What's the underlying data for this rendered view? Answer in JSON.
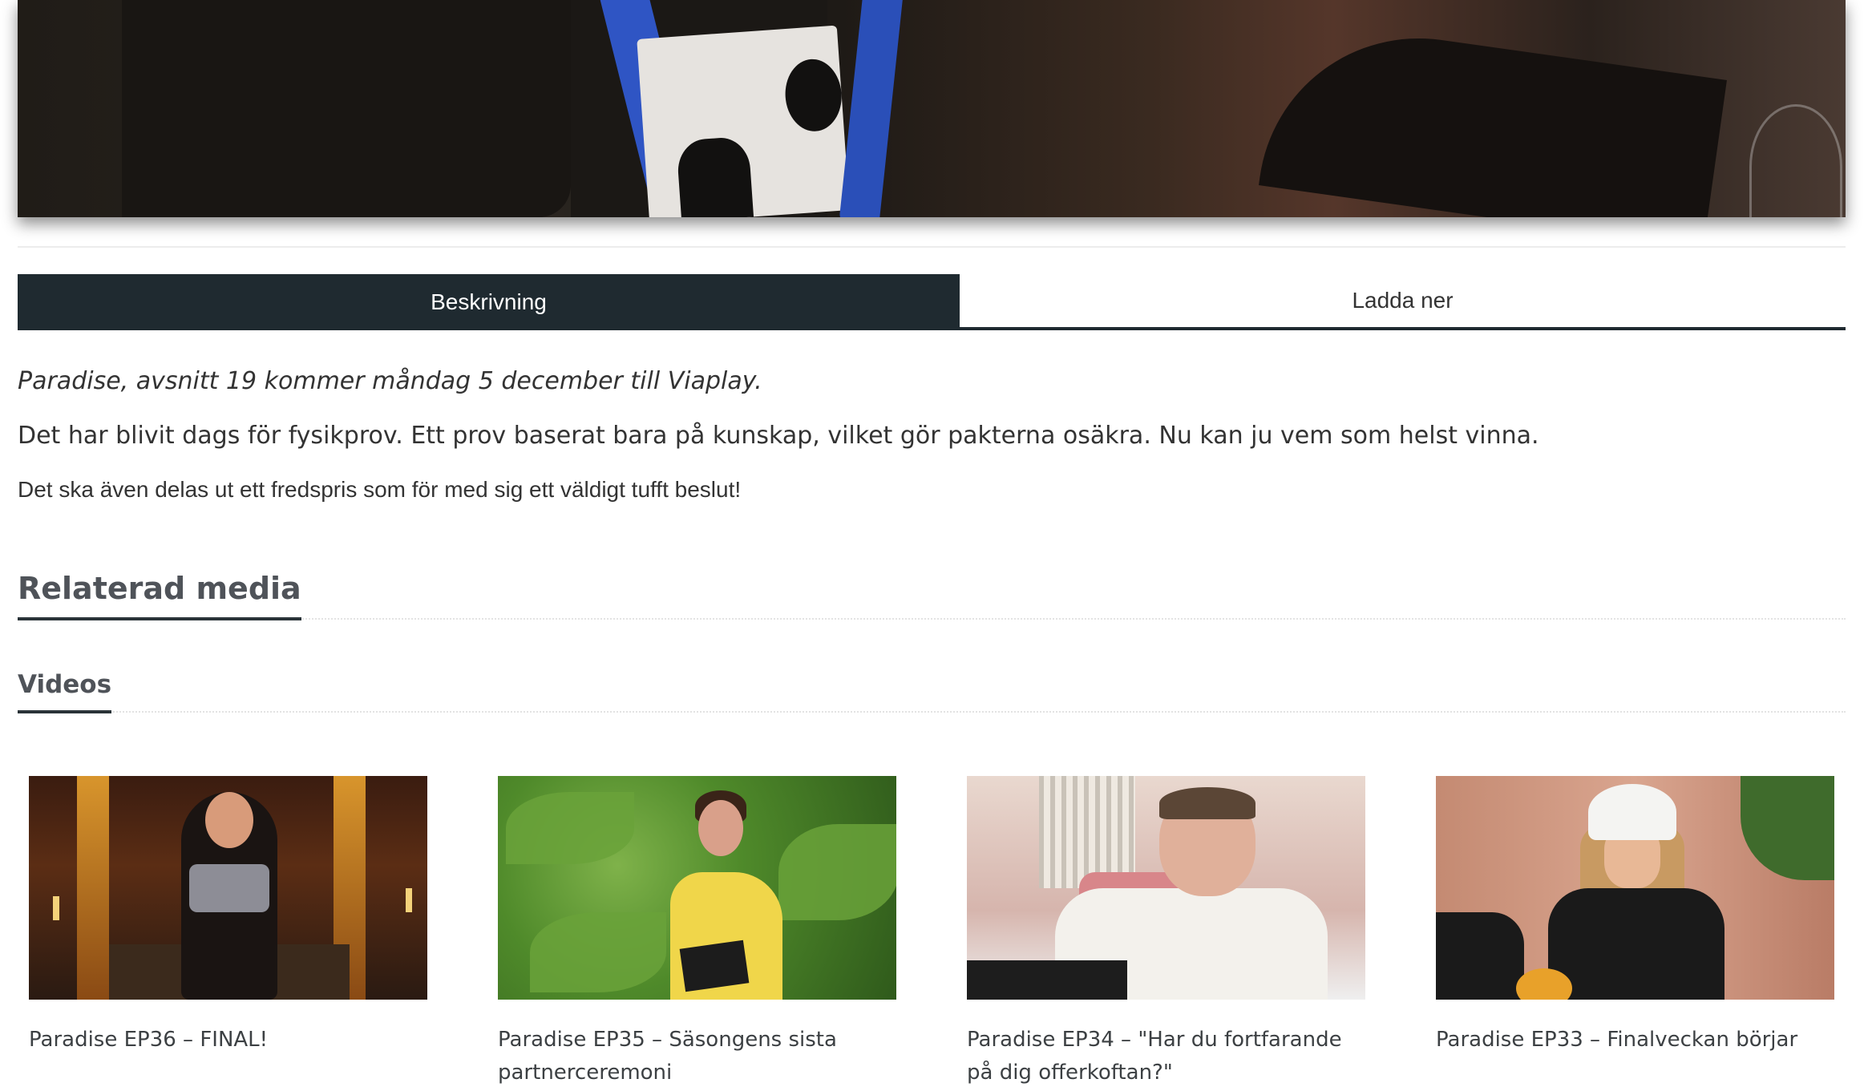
{
  "tabs": {
    "description_label": "Beskrivning",
    "download_label": "Ladda ner"
  },
  "description": {
    "italic_line": "Paradise, avsnitt 19 kommer måndag 5 december till Viaplay.",
    "paragraph_1": "Det har blivit dags för fysikprov. Ett prov baserat bara på kunskap, vilket gör pakterna osäkra. Nu kan ju vem som helst vinna.",
    "paragraph_2": "Det ska även delas ut ett fredspris som för med sig ett väldigt tufft beslut!"
  },
  "related": {
    "heading": "Relaterad media",
    "videos_heading": "Videos"
  },
  "videos": [
    {
      "title": "Paradise EP36 – FINAL!"
    },
    {
      "title": "Paradise EP35 – Säsongens sista partnerceremoni"
    },
    {
      "title": "Paradise EP34 – \"Har du fortfarande på dig offerkoftan?\""
    },
    {
      "title": "Paradise EP33 – Finalveckan börjar"
    }
  ],
  "colors": {
    "tab_active_bg": "#1f2a30",
    "heading_text": "#4f5359",
    "body_text": "#333333"
  }
}
